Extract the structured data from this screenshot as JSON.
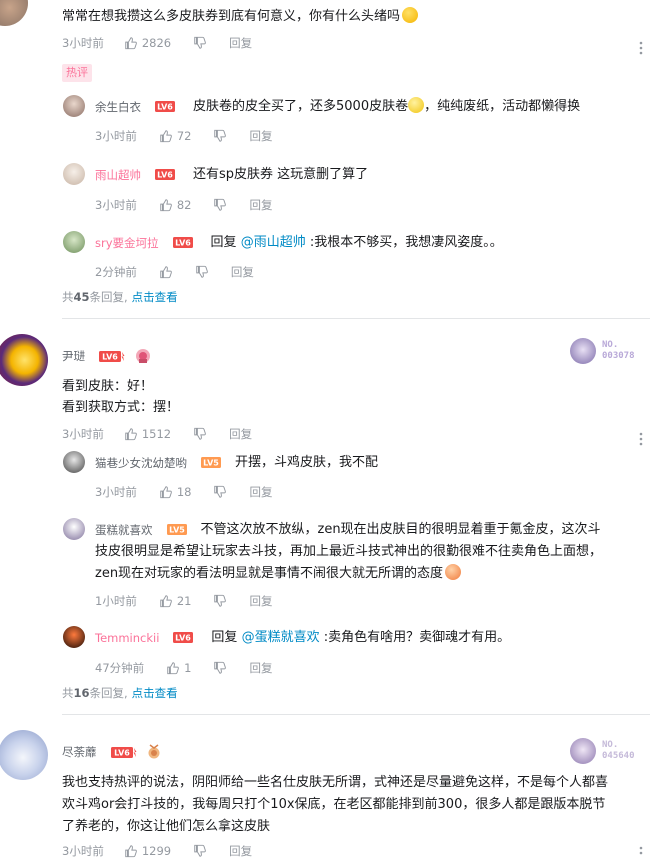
{
  "icons": {
    "like": "thumb-up-icon",
    "dislike": "thumb-down-icon",
    "more": "more-vertical-icon"
  },
  "colors": {
    "accent": "#fb7299",
    "link": "#008ac5",
    "muted": "#9499a0",
    "level6": "#f04c49",
    "level5": "#ff9a51"
  },
  "reply_label": "回复",
  "c1": {
    "text": "常常在想我攒这么多皮肤券到底有何意义，你有什么头绪吗",
    "time": "3小时前",
    "likes": "2826",
    "hot_tag": "热评",
    "replies": [
      {
        "user": "余生白衣",
        "level": "LV6",
        "text": "皮肤卷的皮全买了，还多5000皮肤卷",
        "text2": "，纯纯废纸，活动都懒得换",
        "time": "3小时前",
        "likes": "72"
      },
      {
        "user": "雨山超帅",
        "level": "LV6",
        "text": "还有sp皮肤券 这玩意删了算了",
        "time": "3小时前",
        "likes": "82"
      },
      {
        "user": "sry要金坷拉",
        "level": "LV6",
        "prefix": "回复",
        "mention": "@雨山超帅",
        "text": ":我根本不够买，我想凄风姿度。。",
        "time": "2分钟前"
      }
    ],
    "summary_a": "共",
    "summary_count": "45",
    "summary_b": "条回复,",
    "summary_link": "点击查看"
  },
  "c2": {
    "user": "尹琎",
    "level": "LV6",
    "card_label": "NO.",
    "card_no": "003078",
    "line1": "看到皮肤：好！",
    "line2": "看到获取方式：摆！",
    "time": "3小时前",
    "likes": "1512",
    "replies": [
      {
        "user": "猫巷少女沈幼楚哟",
        "level": "LV5",
        "text": "开摆，斗鸡皮肤，我不配",
        "time": "3小时前",
        "likes": "18"
      },
      {
        "user": "蛋糕就喜欢",
        "level": "LV5",
        "text1": "不管这次放不放纵，zen现在出皮肤目的很明显着重于氪金皮，这次斗",
        "text2": "技皮很明显是希望让玩家去斗技，再加上最近斗技式神出的很勤很难不往卖角色上面想，",
        "text3": "zen现在对玩家的看法明显就是事情不闹很大就无所谓的态度",
        "time": "1小时前",
        "likes": "21"
      },
      {
        "user": "Temminckii",
        "level": "LV6",
        "prefix": "回复",
        "mention": "@蛋糕就喜欢",
        "text": ":卖角色有啥用？卖御魂才有用。",
        "time": "47分钟前",
        "likes": "1"
      }
    ],
    "summary_a": "共",
    "summary_count": "16",
    "summary_b": "条回复,",
    "summary_link": "点击查看"
  },
  "c3": {
    "user": "尽荼蘼",
    "level": "LV6",
    "card_label": "NO.",
    "card_no": "045640",
    "line1": "我也支持热评的说法，阴阳师给一些名仕皮肤无所谓，式神还是尽量避免这样，不是每个人都喜",
    "line2": "欢斗鸡or会打斗技的，我每周只打个10x保底，在老区都能排到前300，很多人都是跟版本脱节",
    "line3": "了养老的，你这让他们怎么拿这皮肤",
    "time": "3小时前",
    "likes": "1299"
  }
}
